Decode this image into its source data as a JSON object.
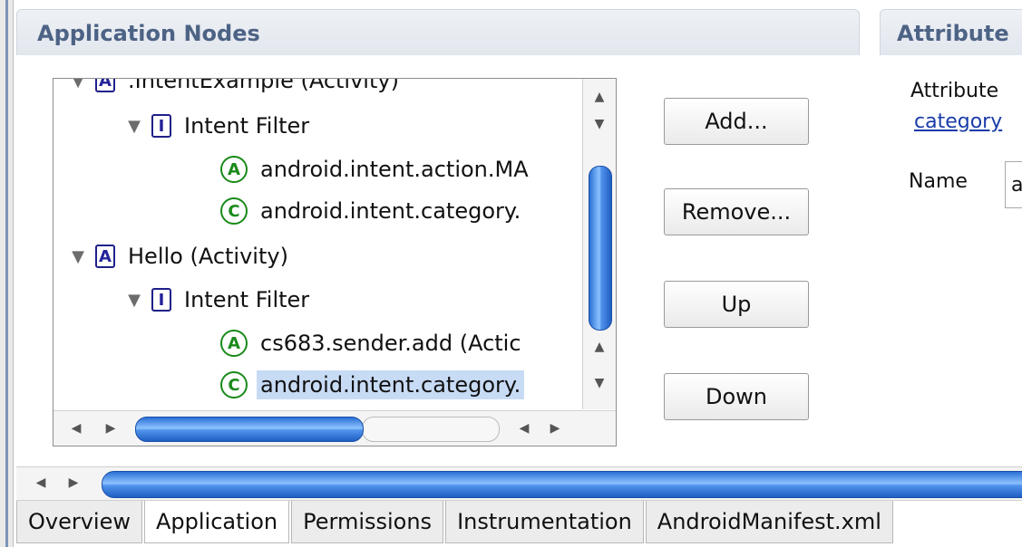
{
  "sections": {
    "application_nodes_title": "Application Nodes",
    "attributes_title": "Attribute"
  },
  "tree": {
    "rows": [
      {
        "label": ".IntentExample (Activity)",
        "icon": "A"
      },
      {
        "label": "Intent Filter",
        "icon": "I"
      },
      {
        "label": "android.intent.action.MA",
        "icon": "A"
      },
      {
        "label": "android.intent.category.",
        "icon": "C"
      },
      {
        "label": "Hello (Activity)",
        "icon": "A"
      },
      {
        "label": "Intent Filter",
        "icon": "I"
      },
      {
        "label": "cs683.sender.add (Actic",
        "icon": "A"
      },
      {
        "label": "android.intent.category.",
        "icon": "C"
      }
    ]
  },
  "buttons": {
    "add": "Add...",
    "remove": "Remove...",
    "up": "Up",
    "down": "Down"
  },
  "attributes": {
    "label": "Attribute",
    "link": "category",
    "name_label": "Name",
    "name_value": "a"
  },
  "tabs": [
    "Overview",
    "Application",
    "Permissions",
    "Instrumentation",
    "AndroidManifest.xml"
  ],
  "colors": {
    "section_title": "#4d6385",
    "selection": "#c7dbf5",
    "scroll_thumb": "#4f92eb",
    "activity_icon": "#22229a",
    "component_icon": "#1a8a1a"
  }
}
